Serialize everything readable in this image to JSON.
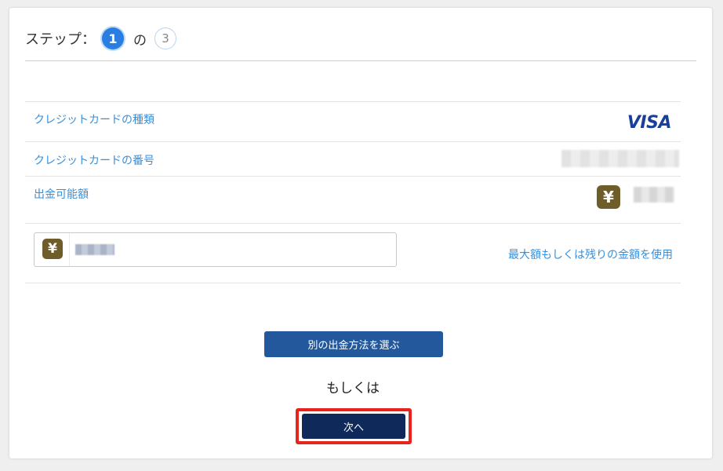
{
  "stepper": {
    "label": "ステップ：",
    "current": "1",
    "of": "の",
    "total": "3"
  },
  "rows": {
    "card_type_label": "クレジットカードの種類",
    "card_type_brand": "VISA",
    "card_number_label": "クレジットカードの番号",
    "available_label": "出金可能額",
    "currency_symbol": "¥"
  },
  "amount_input": {
    "currency_symbol": "¥"
  },
  "links": {
    "use_max": "最大額もしくは残りの金額を使用"
  },
  "buttons": {
    "alternate": "別の出金方法を選ぶ",
    "or": "もしくは",
    "next": "次へ"
  },
  "colors": {
    "accent": "#2a7de1",
    "link": "#3a8fd8",
    "alt_button": "#24589c",
    "next_button": "#0f2a5a",
    "highlight": "#e8231d",
    "yen_badge": "#6e5c2a"
  },
  "icons": {
    "visa": "visa-logo",
    "yen": "yen-icon"
  }
}
